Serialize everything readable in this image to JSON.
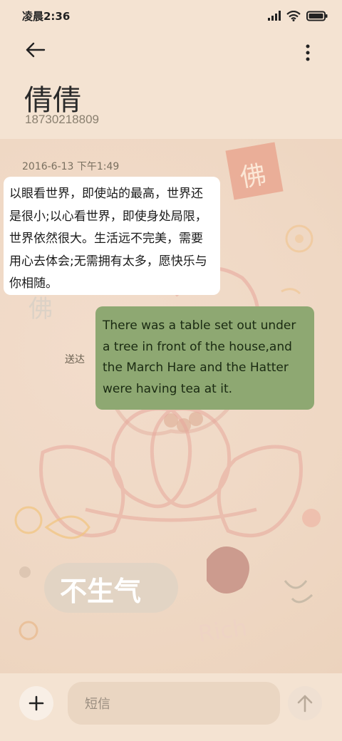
{
  "status_bar": {
    "time": "凌晨2:36",
    "icons": [
      "signal-icon",
      "wifi-icon",
      "battery-icon"
    ]
  },
  "header": {
    "back_icon": "arrow-left-icon",
    "more_icon": "more-vertical-icon",
    "contact_name": "倩倩",
    "contact_number": "18730218809"
  },
  "conversation": {
    "timestamp": "2016-6-13 下午1:49",
    "incoming": {
      "text": "以眼看世界，即使站的最高，世界还是很小;以心看世界，即使身处局限，世界依然很大。生活远不完美，需要用心去体会;无需拥有太多，愿快乐与你相随。"
    },
    "outgoing": {
      "text": "There was a table set out under a tree in front of the house,and the March Hare and the Hatter were having tea at it.",
      "status": "送达"
    }
  },
  "composer": {
    "add_icon": "plus-icon",
    "placeholder": "短信",
    "send_icon": "send-arrow-icon"
  },
  "wallpaper": {
    "stamp_text": "佛",
    "mood_text": "不生气",
    "rich_text": "Rich"
  },
  "colors": {
    "background": "#f4e3d2",
    "incoming_bubble": "#ffffff",
    "outgoing_bubble": "#8ea872"
  }
}
